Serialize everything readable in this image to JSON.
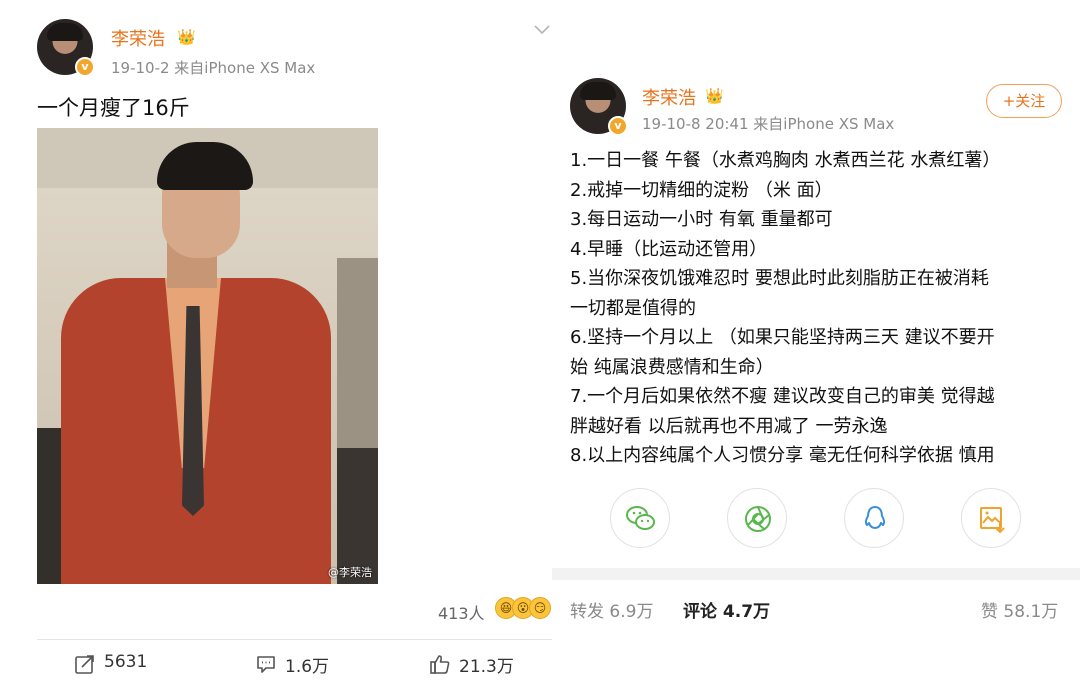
{
  "left_post": {
    "username": "李荣浩",
    "crown_icon": "👑",
    "meta": "19-10-2  来自iPhone XS Max",
    "text": "一个月瘦了16斤",
    "watermark": "@李荣浩",
    "reactions": {
      "count": "413人",
      "emojis": [
        "😆",
        "😮",
        "😏"
      ]
    },
    "actions": {
      "repost": "5631",
      "comment": "1.6万",
      "like": "21.3万"
    }
  },
  "right_post": {
    "username": "李荣浩",
    "crown_icon": "👑",
    "meta": "19-10-8 20:41  来自iPhone XS Max",
    "follow_label": "+关注",
    "lines": [
      "1.一日一餐 午餐（水煮鸡胸肉 水煮西兰花 水煮红薯）",
      "2.戒掉一切精细的淀粉 （米 面）",
      "3.每日运动一小时 有氧 重量都可",
      "4.早睡（比运动还管用）",
      "5.当你深夜饥饿难忍时 要想此时此刻脂肪正在被消耗",
      "一切都是值得的",
      "6.坚持一个月以上 （如果只能坚持两三天 建议不要开",
      "始 纯属浪费感情和生命）",
      "7.一个月后如果依然不瘦 建议改变自己的审美 觉得越",
      "胖越好看 以后就再也不用减了 一劳永逸",
      "8.以上内容纯属个人习惯分享 毫无任何科学依据 慎用"
    ],
    "share_icons": [
      "wechat-icon",
      "moments-icon",
      "qq-icon",
      "save-image-icon"
    ],
    "stats": {
      "repost": "转发 6.9万",
      "comment": "评论 4.7万",
      "like": "赞 58.1万"
    }
  },
  "colors": {
    "accent": "#e8731a",
    "muted": "#8a8a8a",
    "share_green": "#59b84d",
    "share_blue": "#3b8fd8",
    "share_orange": "#f0a32d"
  }
}
